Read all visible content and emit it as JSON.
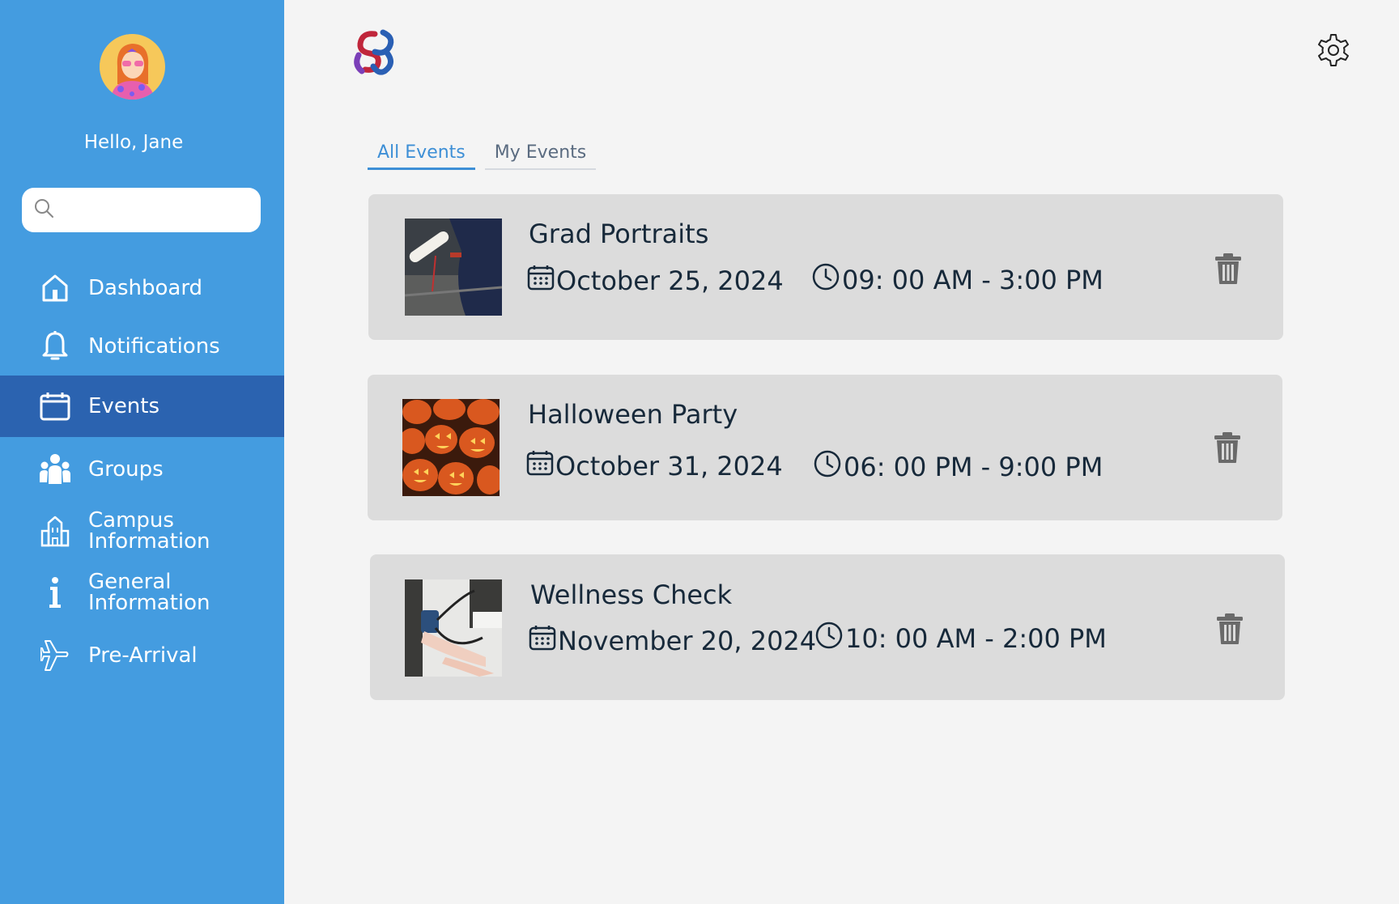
{
  "sidebar": {
    "greeting": "Hello, Jane",
    "search": {
      "placeholder": ""
    },
    "items": [
      {
        "label": "Dashboard",
        "icon": "home-icon"
      },
      {
        "label": "Notifications",
        "icon": "bell-icon"
      },
      {
        "label": "Events",
        "icon": "calendar-icon",
        "active": true
      },
      {
        "label": "Groups",
        "icon": "group-icon"
      },
      {
        "label_line1": "Campus",
        "label_line2": "Information",
        "icon": "building-icon"
      },
      {
        "label_line1": "General",
        "label_line2": "Information",
        "icon": "info-icon"
      },
      {
        "label": "Pre-Arrival",
        "icon": "airplane-icon"
      }
    ]
  },
  "header": {
    "logo_icon": "app-logo",
    "settings_icon": "gear-icon"
  },
  "tabs": [
    {
      "label": "All Events",
      "active": true
    },
    {
      "label": "My Events",
      "active": false
    }
  ],
  "events": [
    {
      "title": "Grad Portraits",
      "date": "October 25, 2024",
      "time": "09: 00 AM - 3:00 PM",
      "thumbnail": "graduation-diploma-photo"
    },
    {
      "title": "Halloween Party",
      "date": "October 31, 2024",
      "time": "06: 00 PM - 9:00 PM",
      "thumbnail": "jack-o-lanterns-photo"
    },
    {
      "title": "Wellness Check",
      "date": "November 20, 2024",
      "time": "10: 00 AM - 2:00 PM",
      "thumbnail": "blood-pressure-check-photo"
    }
  ],
  "colors": {
    "sidebar_bg": "#449ce0",
    "sidebar_active": "#2b63b0",
    "tab_active": "#3d8fd6",
    "card_bg": "#dcdcdc",
    "text_dark": "#17293a",
    "page_bg": "#f4f4f4"
  }
}
